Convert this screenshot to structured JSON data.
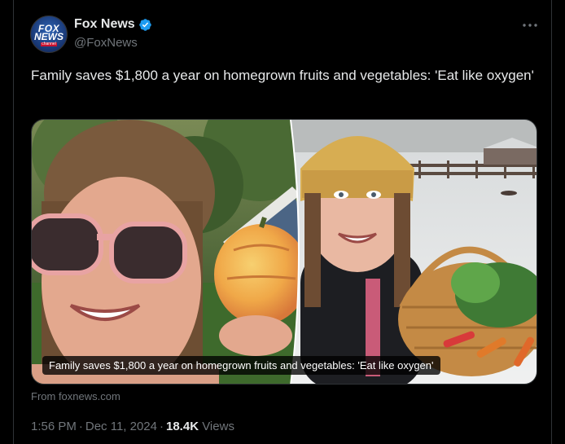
{
  "author": {
    "name": "Fox News",
    "handle": "@FoxNews",
    "avatar_logo_line1": "FOX",
    "avatar_logo_line2": "NEWS",
    "avatar_logo_line3": "channel",
    "verified": true
  },
  "tweet": {
    "text": "Family saves $1,800 a year on homegrown fruits and vegetables: 'Eat like oxygen'"
  },
  "card": {
    "caption": "Family saves $1,800 a year on homegrown fruits and vegetables: 'Eat like oxygen'",
    "source": "From foxnews.com"
  },
  "meta": {
    "time": "1:56 PM",
    "date": "Dec 11, 2024",
    "views_count": "18.4K",
    "views_label": "Views"
  },
  "colors": {
    "background": "#000000",
    "text_primary": "#e7e9ea",
    "text_secondary": "#71767b",
    "verified_blue": "#1d9bf0",
    "border": "#2f3336"
  }
}
